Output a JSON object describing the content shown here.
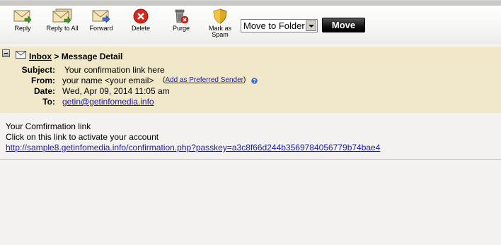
{
  "toolbar": {
    "buttons": [
      {
        "label": "Reply",
        "icon": "reply-icon"
      },
      {
        "label": "Reply to All",
        "icon": "reply-all-icon"
      },
      {
        "label": "Forward",
        "icon": "forward-icon"
      },
      {
        "label": "Delete",
        "icon": "delete-icon"
      },
      {
        "label": "Purge",
        "icon": "purge-icon"
      },
      {
        "label": "Mark as Spam",
        "icon": "spam-shield-icon"
      }
    ],
    "folder_select": "Move to Folder",
    "move_label": "Move"
  },
  "breadcrumb": {
    "inbox": "Inbox",
    "separator": " > ",
    "current": "Message Detail"
  },
  "message": {
    "subject_label": "Subject:",
    "subject": "Your confirmation link here",
    "from_label": "From:",
    "from": "your name <your email>",
    "add_preferred": "Add as Preferred Sender",
    "date_label": "Date:",
    "date": "Wed, Apr 09, 2014 11:05 am",
    "to_label": "To:",
    "to": "getin@getinfomedia.info"
  },
  "body": {
    "line1": "Your Comfirmation link",
    "line2": "Click on this link to activate your account",
    "link": "http://sample8.getinfomedia.info/confirmation.php?passkey=a3c8f66d244b3569784056779b74bae4"
  },
  "colors": {
    "header_bg": "#f1e8c9",
    "link": "#1a1aa6",
    "page_bg": "#f3f2f0"
  }
}
